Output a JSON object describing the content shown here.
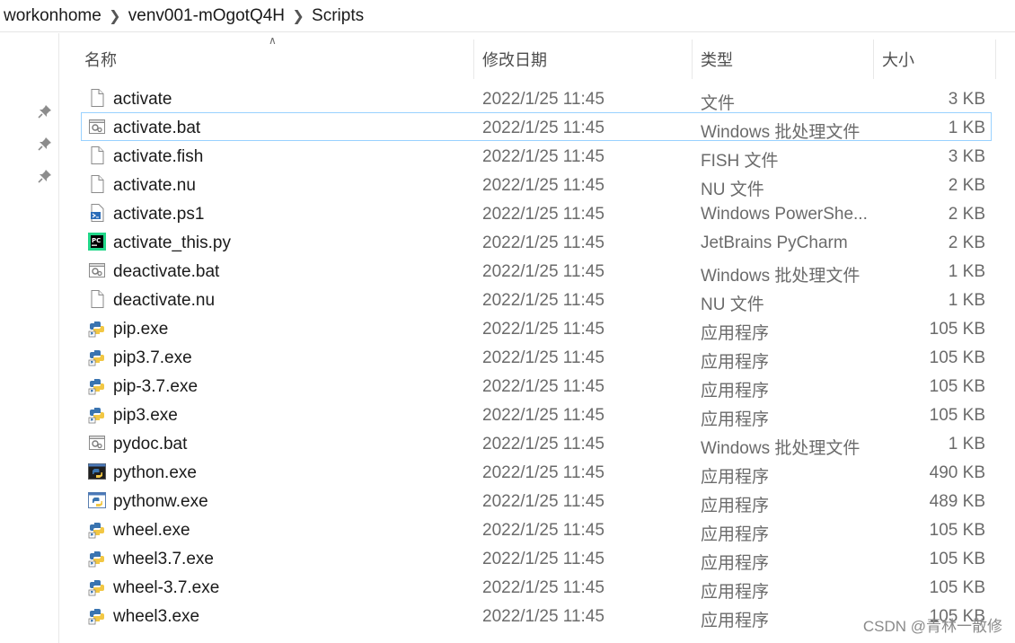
{
  "breadcrumb": [
    "workonhome",
    "venv001-mOgotQ4H",
    "Scripts"
  ],
  "columns": {
    "name": "名称",
    "date": "修改日期",
    "type": "类型",
    "size": "大小"
  },
  "files": [
    {
      "name": "activate",
      "date": "2022/1/25 11:45",
      "type": "文件",
      "size": "3 KB",
      "icon": "file-icon"
    },
    {
      "name": "activate.bat",
      "date": "2022/1/25 11:45",
      "type": "Windows 批处理文件",
      "size": "1 KB",
      "icon": "batch-file-icon",
      "selected": true
    },
    {
      "name": "activate.fish",
      "date": "2022/1/25 11:45",
      "type": "FISH 文件",
      "size": "3 KB",
      "icon": "file-icon"
    },
    {
      "name": "activate.nu",
      "date": "2022/1/25 11:45",
      "type": "NU 文件",
      "size": "2 KB",
      "icon": "file-icon"
    },
    {
      "name": "activate.ps1",
      "date": "2022/1/25 11:45",
      "type": "Windows PowerShe...",
      "size": "2 KB",
      "icon": "powershell-script-icon"
    },
    {
      "name": "activate_this.py",
      "date": "2022/1/25 11:45",
      "type": "JetBrains PyCharm",
      "size": "2 KB",
      "icon": "pycharm-icon"
    },
    {
      "name": "deactivate.bat",
      "date": "2022/1/25 11:45",
      "type": "Windows 批处理文件",
      "size": "1 KB",
      "icon": "batch-file-icon"
    },
    {
      "name": "deactivate.nu",
      "date": "2022/1/25 11:45",
      "type": "NU 文件",
      "size": "1 KB",
      "icon": "file-icon"
    },
    {
      "name": "pip.exe",
      "date": "2022/1/25 11:45",
      "type": "应用程序",
      "size": "105 KB",
      "icon": "python-exe-icon"
    },
    {
      "name": "pip3.7.exe",
      "date": "2022/1/25 11:45",
      "type": "应用程序",
      "size": "105 KB",
      "icon": "python-exe-icon"
    },
    {
      "name": "pip-3.7.exe",
      "date": "2022/1/25 11:45",
      "type": "应用程序",
      "size": "105 KB",
      "icon": "python-exe-icon"
    },
    {
      "name": "pip3.exe",
      "date": "2022/1/25 11:45",
      "type": "应用程序",
      "size": "105 KB",
      "icon": "python-exe-icon"
    },
    {
      "name": "pydoc.bat",
      "date": "2022/1/25 11:45",
      "type": "Windows 批处理文件",
      "size": "1 KB",
      "icon": "batch-file-icon"
    },
    {
      "name": "python.exe",
      "date": "2022/1/25 11:45",
      "type": "应用程序",
      "size": "490 KB",
      "icon": "console-app-icon"
    },
    {
      "name": "pythonw.exe",
      "date": "2022/1/25 11:45",
      "type": "应用程序",
      "size": "489 KB",
      "icon": "window-app-icon"
    },
    {
      "name": "wheel.exe",
      "date": "2022/1/25 11:45",
      "type": "应用程序",
      "size": "105 KB",
      "icon": "python-exe-icon"
    },
    {
      "name": "wheel3.7.exe",
      "date": "2022/1/25 11:45",
      "type": "应用程序",
      "size": "105 KB",
      "icon": "python-exe-icon"
    },
    {
      "name": "wheel-3.7.exe",
      "date": "2022/1/25 11:45",
      "type": "应用程序",
      "size": "105 KB",
      "icon": "python-exe-icon"
    },
    {
      "name": "wheel3.exe",
      "date": "2022/1/25 11:45",
      "type": "应用程序",
      "size": "105 KB",
      "icon": "python-exe-icon"
    }
  ],
  "watermark": "CSDN @青林一散修",
  "colors": {
    "selection_border": "#99d1ff",
    "secondary_text": "#6b6b6b"
  }
}
